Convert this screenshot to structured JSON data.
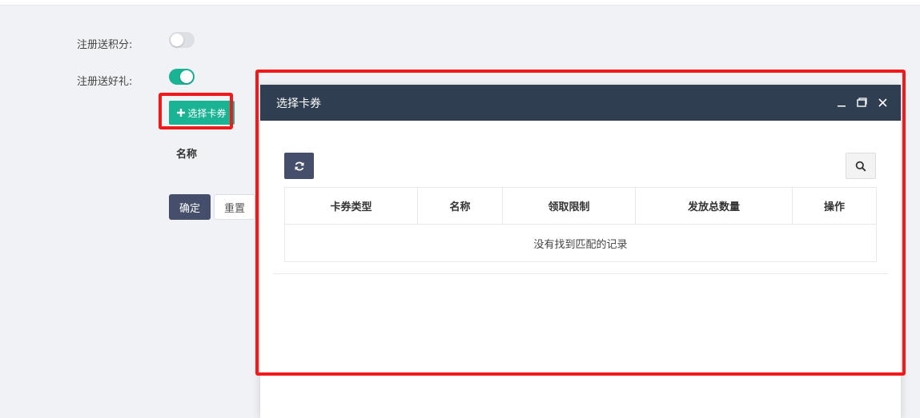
{
  "form": {
    "points_label": "注册送积分:",
    "points_enabled": false,
    "gift_label": "注册送好礼:",
    "gift_enabled": true,
    "select_coupon_button": "选择卡券",
    "table_name_header": "名称",
    "confirm_button": "确定",
    "reset_button": "重置"
  },
  "dialog": {
    "title": "选择卡券",
    "columns": [
      "卡券类型",
      "名称",
      "领取限制",
      "发放总数量",
      "操作"
    ],
    "empty_message": "没有找到匹配的记录"
  },
  "icons": {
    "plus": "plus-icon",
    "refresh": "refresh-icon",
    "search": "search-icon",
    "minimize": "minimize-icon",
    "maximize": "maximize-icon",
    "close": "close-icon"
  },
  "colors": {
    "accent": "#1ab394",
    "dark": "#2f3e51",
    "button_dark": "#454e6b",
    "highlight": "#f2191b"
  }
}
